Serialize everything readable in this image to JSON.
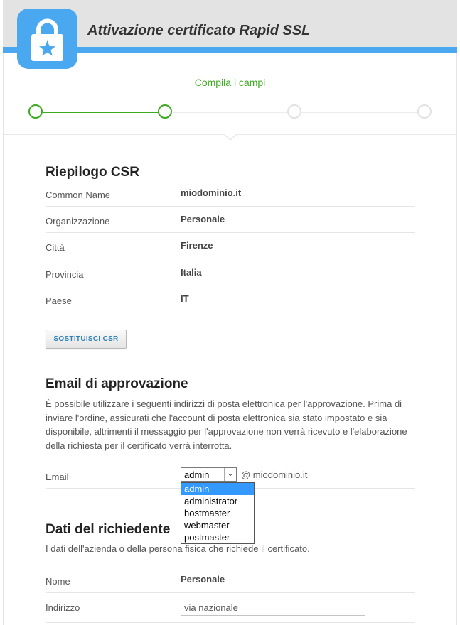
{
  "header": {
    "title": "Attivazione certificato Rapid SSL",
    "logo_icon": "lock-star-icon",
    "accent": "#4aa8f0"
  },
  "steps": {
    "caption": "Compila i campi",
    "total": 4,
    "active": 2,
    "active_color": "#3caa1e"
  },
  "csr": {
    "title": "Riepilogo CSR",
    "rows": [
      {
        "label": "Common Name",
        "value": "miodominio.it"
      },
      {
        "label": "Organizzazione",
        "value": "Personale"
      },
      {
        "label": "Città",
        "value": "Firenze"
      },
      {
        "label": "Provincia",
        "value": "Italia"
      },
      {
        "label": "Paese",
        "value": "IT"
      }
    ],
    "button": "SOSTITUISCI CSR"
  },
  "approval": {
    "title": "Email di approvazione",
    "description": "È possibile utilizzare i seguenti indirizzi di posta elettronica per l'approvazione. Prima di inviare l'ordine, assicurati che l'account di posta elettronica sia stato impostato e sia disponibile, altrimenti il messaggio per l'approvazione non verrà ricevuto e l'elaborazione della richiesta per il certificato verrà interrotta.",
    "email_label": "Email",
    "selected": "admin",
    "domain": "@ miodominio.it",
    "options": [
      "admin",
      "administrator",
      "hostmaster",
      "webmaster",
      "postmaster"
    ]
  },
  "applicant": {
    "title": "Dati del richiedente",
    "subtitle": "I dati dell'azienda o della persona fisica che richiede il certificato.",
    "name_label": "Nome",
    "name_value": "Personale",
    "address_label": "Indirizzo",
    "address_value": "via nazionale"
  }
}
